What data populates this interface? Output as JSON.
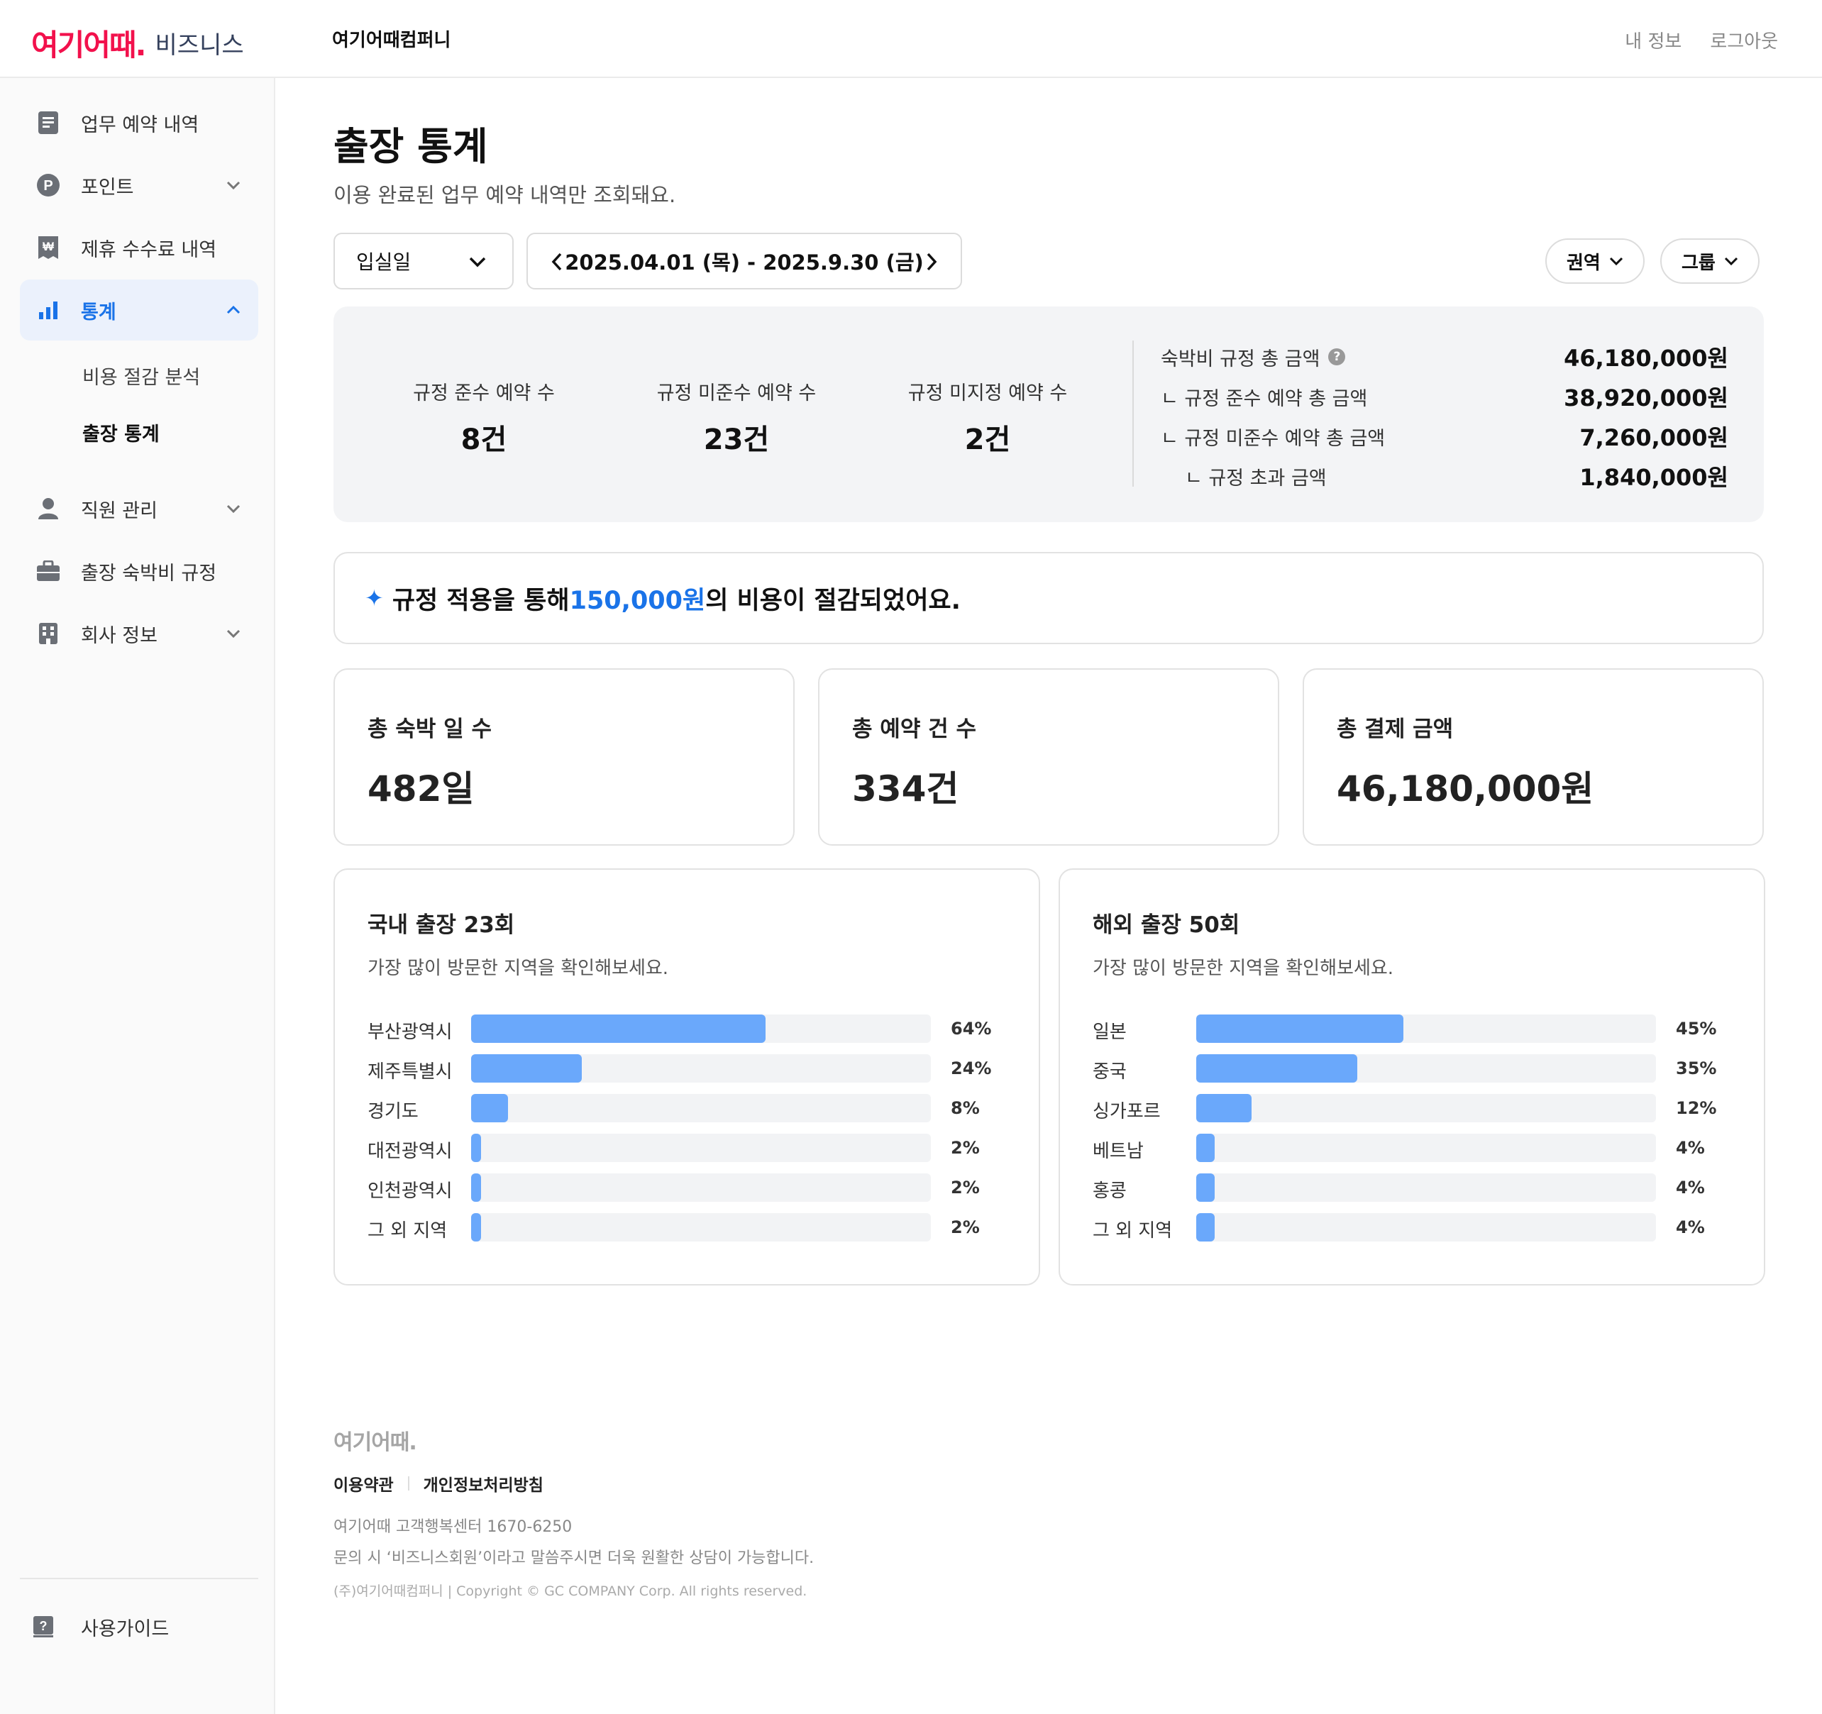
{
  "header": {
    "logo_mark": "여기어때.",
    "logo_sub": "비즈니스",
    "company": "여기어때컴퍼니",
    "links": [
      "내 정보",
      "로그아웃"
    ]
  },
  "sidebar": {
    "items": [
      {
        "label": "업무 예약 내역",
        "icon": "document-icon"
      },
      {
        "label": "포인트",
        "icon": "point-icon"
      },
      {
        "label": "제휴 수수료 내역",
        "icon": "won-receipt-icon"
      },
      {
        "label": "통계",
        "icon": "bar-chart-icon"
      },
      {
        "label": "직원 관리",
        "icon": "person-icon"
      },
      {
        "label": "출장 숙박비 규정",
        "icon": "briefcase-icon"
      },
      {
        "label": "회사 정보",
        "icon": "building-icon"
      }
    ],
    "sub_items": [
      "비용 절감 분석",
      "출장 통계"
    ],
    "guide": "사용가이드"
  },
  "page": {
    "title": "출장 통계",
    "subtitle": "이용 완료된 업무 예약 내역만 조회돼요."
  },
  "filters": {
    "date_type": "입실일",
    "date_range": "2025.04.01 (목) - 2025.9.30 (금)",
    "region": "권역",
    "group": "그룹"
  },
  "summary": {
    "stats": [
      {
        "label": "규정 준수 예약 수",
        "value": "8건"
      },
      {
        "label": "규정 미준수 예약 수",
        "value": "23건"
      },
      {
        "label": "규정 미지정 예약 수",
        "value": "2건"
      }
    ],
    "amounts": [
      {
        "label": "숙박비 규정 총 금액",
        "value": "46,180,000원"
      },
      {
        "label": "ㄴ 규정 준수 예약 총 금액",
        "value": "38,920,000원"
      },
      {
        "label": "ㄴ 규정 미준수 예약 총 금액",
        "value": "7,260,000원"
      },
      {
        "label": "ㄴ 규정 초과 금액",
        "value": "1,840,000원"
      }
    ]
  },
  "banner": {
    "prefix": "규정 적용을 통해 ",
    "amount": "150,000원",
    "suffix": "의 비용이 절감되었어요."
  },
  "cards": [
    {
      "label": "총 숙박 일 수",
      "value": "482일"
    },
    {
      "label": "총 예약 건 수",
      "value": "334건"
    },
    {
      "label": "총 결제 금액",
      "value": "46,180,000원"
    }
  ],
  "chart_data": [
    {
      "type": "bar",
      "title": "국내 출장 23회",
      "subtitle": "가장 많이 방문한 지역을 확인해보세요.",
      "categories": [
        "부산광역시",
        "제주특별시",
        "경기도",
        "대전광역시",
        "인천광역시",
        "그 외 지역"
      ],
      "values": [
        64,
        24,
        8,
        2,
        2,
        2
      ],
      "value_labels": [
        "64%",
        "24%",
        "8%",
        "2%",
        "2%",
        "2%"
      ],
      "ylim": [
        0,
        100
      ],
      "color": "#6aa8fb"
    },
    {
      "type": "bar",
      "title": "해외 출장 50회",
      "subtitle": "가장 많이 방문한 지역을 확인해보세요.",
      "categories": [
        "일본",
        "중국",
        "싱가포르",
        "베트남",
        "홍콩",
        "그 외 지역"
      ],
      "values": [
        45,
        35,
        12,
        4,
        4,
        4
      ],
      "value_labels": [
        "45%",
        "35%",
        "12%",
        "4%",
        "4%",
        "4%"
      ],
      "ylim": [
        0,
        100
      ],
      "color": "#6aa8fb"
    }
  ],
  "footer": {
    "logo": "여기어때.",
    "links": [
      "이용약관",
      "개인정보처리방침"
    ],
    "line1": "여기어때 고객행복센터 1670-6250",
    "line2": "문의 시 ‘비즈니스회원’이라고 말씀주시면 더욱 원활한 상담이 가능합니다.",
    "copyright": "(주)여기어때컴퍼니 | Copyright © GC COMPANY Corp. All rights reserved."
  },
  "colors": {
    "brand": "#f2114c",
    "accent": "#1a73e8",
    "bar": "#6aa8fb"
  }
}
